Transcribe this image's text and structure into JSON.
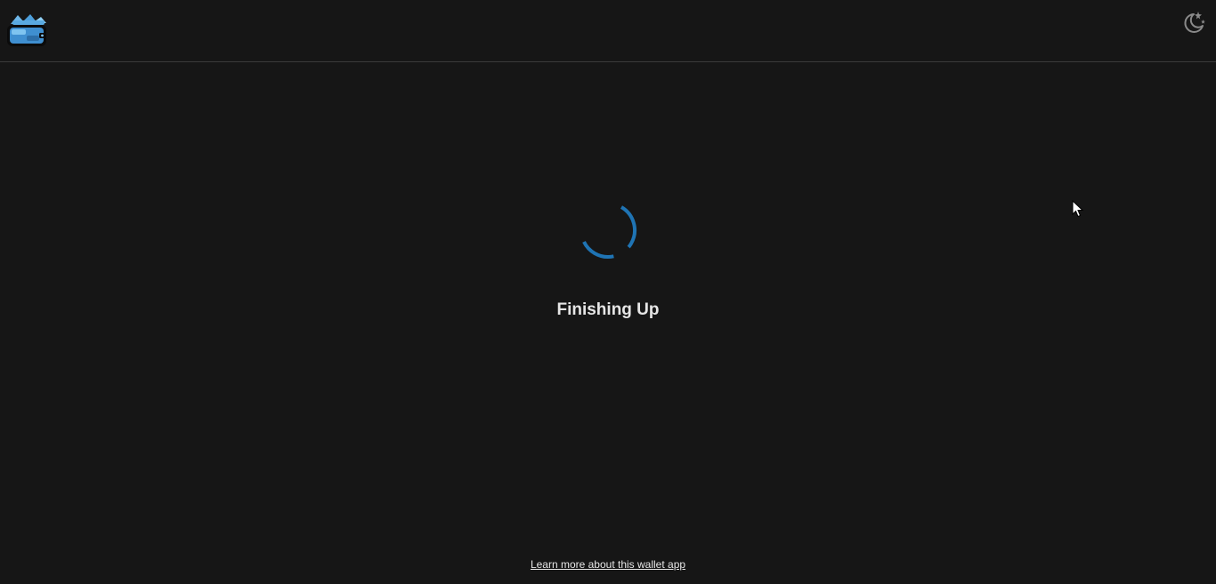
{
  "header": {
    "logo_icon": "wallet-logo-icon",
    "theme_toggle_icon": "moon-stars-icon"
  },
  "main": {
    "status_text": "Finishing Up",
    "spinner_icon": "loading-spinner-icon",
    "spinner_color": "#1f74b4"
  },
  "footer": {
    "link_text": "Learn more about this wallet app"
  },
  "colors": {
    "background": "#161616",
    "divider": "#3a3a3a",
    "text": "#e6e6e6",
    "icon": "#8a8a8a"
  }
}
